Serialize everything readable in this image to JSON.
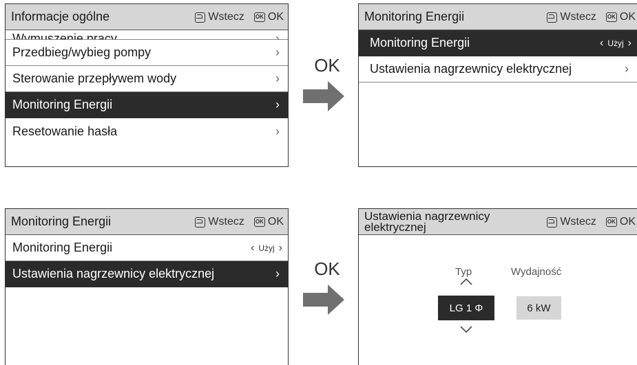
{
  "header": {
    "back_label": "Wstecz",
    "ok_icon": "OK",
    "ok_label": "OK"
  },
  "panel1": {
    "title": "Informacje ogólne",
    "cut_item": "Wymuszenie pracy",
    "items": [
      "Przedbieg/wybieg pompy",
      "Sterowanie przepływem wody",
      "Monitoring Energii",
      "Resetowanie hasła"
    ]
  },
  "panel2": {
    "title": "Monitoring Energii",
    "items": [
      "Monitoring Energii",
      "Ustawienia nagrzewnicy elektrycznej"
    ],
    "use_value": "Użyj"
  },
  "panel3": {
    "title": "Monitoring Energii",
    "items": [
      "Monitoring Energii",
      "Ustawienia nagrzewnicy elektrycznej"
    ],
    "use_value": "Użyj"
  },
  "panel4": {
    "title": "Ustawienia nagrzewnicy elektrycznej",
    "type_label": "Typ",
    "capacity_label": "Wydajność",
    "type_value": "LG 1 Φ",
    "capacity_value": "6 kW"
  },
  "arrows": {
    "label": "OK"
  },
  "colors": {
    "header_bg": "#d6d6d6",
    "selected_bg": "#2b2b2b",
    "arrow": "#707070"
  }
}
